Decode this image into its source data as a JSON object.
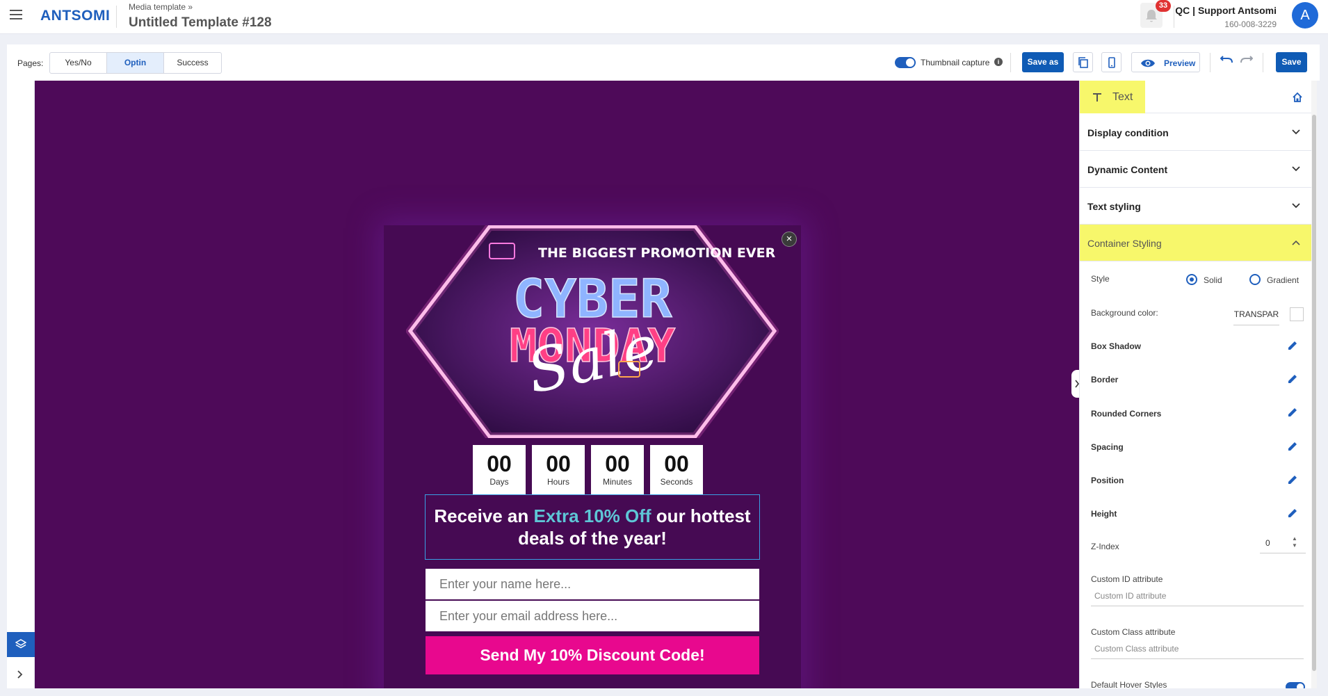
{
  "app": {
    "logo": "ANTSOMI",
    "breadcrumb": "Media template »",
    "template_title": "Untitled Template #128",
    "notifications_count": "33",
    "user_name": "QC | Support Antsomi",
    "user_phone": "160-008-3229",
    "avatar_initial": "A"
  },
  "toolbar": {
    "pages_label": "Pages:",
    "page_tabs": [
      {
        "label": "Yes/No",
        "active": false
      },
      {
        "label": "Optin",
        "active": true
      },
      {
        "label": "Success",
        "active": false
      }
    ],
    "thumbnail_capture_label": "Thumbnail capture",
    "thumbnail_capture_on": true,
    "info_icon": "i",
    "save_as_label": "Save as",
    "preview_label": "Preview",
    "save_label": "Save"
  },
  "popup": {
    "close_glyph": "×",
    "hero_top_text": "THE BIGGEST PROMOTION EVER",
    "hero_line1": "CYBER",
    "hero_line2": "MONDAY",
    "hero_script": "Sale",
    "countdown": [
      {
        "value": "00",
        "label": "Days"
      },
      {
        "value": "00",
        "label": "Hours"
      },
      {
        "value": "00",
        "label": "Minutes"
      },
      {
        "value": "00",
        "label": "Seconds"
      }
    ],
    "headline_pre": "Receive an ",
    "headline_accent": "Extra 10% Off",
    "headline_post": " our hottest deals of the year!",
    "name_placeholder": "Enter your name here...",
    "email_placeholder": "Enter your email address here...",
    "cta_label": "Send My 10% Discount Code!"
  },
  "panel": {
    "element_tab": "Text",
    "sections": [
      {
        "label": "Display condition",
        "expanded": false
      },
      {
        "label": "Dynamic Content",
        "expanded": false
      },
      {
        "label": "Text styling",
        "expanded": false
      },
      {
        "label": "Container Styling",
        "expanded": true
      }
    ],
    "style_label": "Style",
    "style_options": [
      "Solid",
      "Gradient"
    ],
    "style_selected": "Solid",
    "bg_color_label": "Background color:",
    "bg_color_value": "TRANSPAR",
    "props": [
      "Box Shadow",
      "Border",
      "Rounded Corners",
      "Spacing",
      "Position",
      "Height"
    ],
    "zindex_label": "Z-Index",
    "zindex_value": "0",
    "custom_id_label": "Custom ID attribute",
    "custom_id_placeholder": "Custom ID attribute",
    "custom_class_label": "Custom Class attribute",
    "custom_class_placeholder": "Custom Class attribute",
    "hover_label": "Default Hover Styles",
    "hover_on": true
  },
  "colors": {
    "brand": "#1f5fbd",
    "canvas": "#4e0a59",
    "cta": "#e8088e",
    "highlight": "#f7f76b",
    "accent_text": "#5ec6d6"
  }
}
